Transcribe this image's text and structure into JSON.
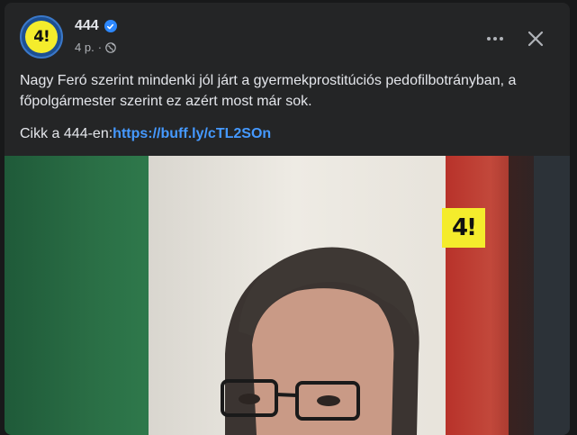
{
  "post": {
    "page_name": "444",
    "avatar_text": "4!",
    "time": "4 p.",
    "separator": "·",
    "text": "Nagy Feró szerint mindenki jól járt a gyermekprostitúciós pedofilbotrányban, a főpolgármester szerint ez azért most már sok.",
    "link_prefix": "Cikk a 444-en:",
    "link_text": "https://buff.ly/cTL2SOn",
    "image_logo_text": "4!"
  },
  "icons": {
    "verified": "verified-badge-icon",
    "audience": "globe-icon",
    "more": "more-options-icon",
    "close": "close-icon"
  },
  "colors": {
    "card_bg": "#242526",
    "link": "#4599ff",
    "verified": "#2d88ff",
    "logo_yellow": "#f4ec2c"
  }
}
